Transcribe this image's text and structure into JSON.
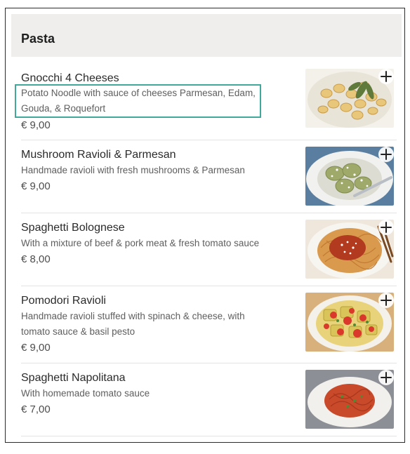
{
  "section": {
    "title": "Pasta"
  },
  "items": [
    {
      "name": "Gnocchi 4 Cheeses",
      "description": "Potato Noodle with sauce of cheeses Parmesan, Edam, Gouda, & Roquefort",
      "price": "€ 9,00",
      "image_icon": "gnocchi-dish-image"
    },
    {
      "name": "Mushroom Ravioli & Parmesan",
      "description": "Handmade ravioli with fresh mushrooms & Parmesan",
      "price": "€ 9,00",
      "image_icon": "mushroom-ravioli-image"
    },
    {
      "name": "Spaghetti Bolognese",
      "description": "With a mixture of beef & pork meat & fresh tomato sauce",
      "price": "€ 8,00",
      "image_icon": "spaghetti-bolognese-image"
    },
    {
      "name": "Pomodori Ravioli",
      "description": "Handmade ravioli stuffed with spinach & cheese, with tomato sauce & basil pesto",
      "price": "€ 9,00",
      "image_icon": "pomodori-ravioli-image"
    },
    {
      "name": "Spaghetti Napolitana",
      "description": "With homemade tomato sauce",
      "price": "€ 7,00",
      "image_icon": "spaghetti-napolitana-image"
    }
  ],
  "colors": {
    "header_bg": "#efeeec",
    "highlight_outline": "#41a99b",
    "divider": "#e3e3e3"
  }
}
